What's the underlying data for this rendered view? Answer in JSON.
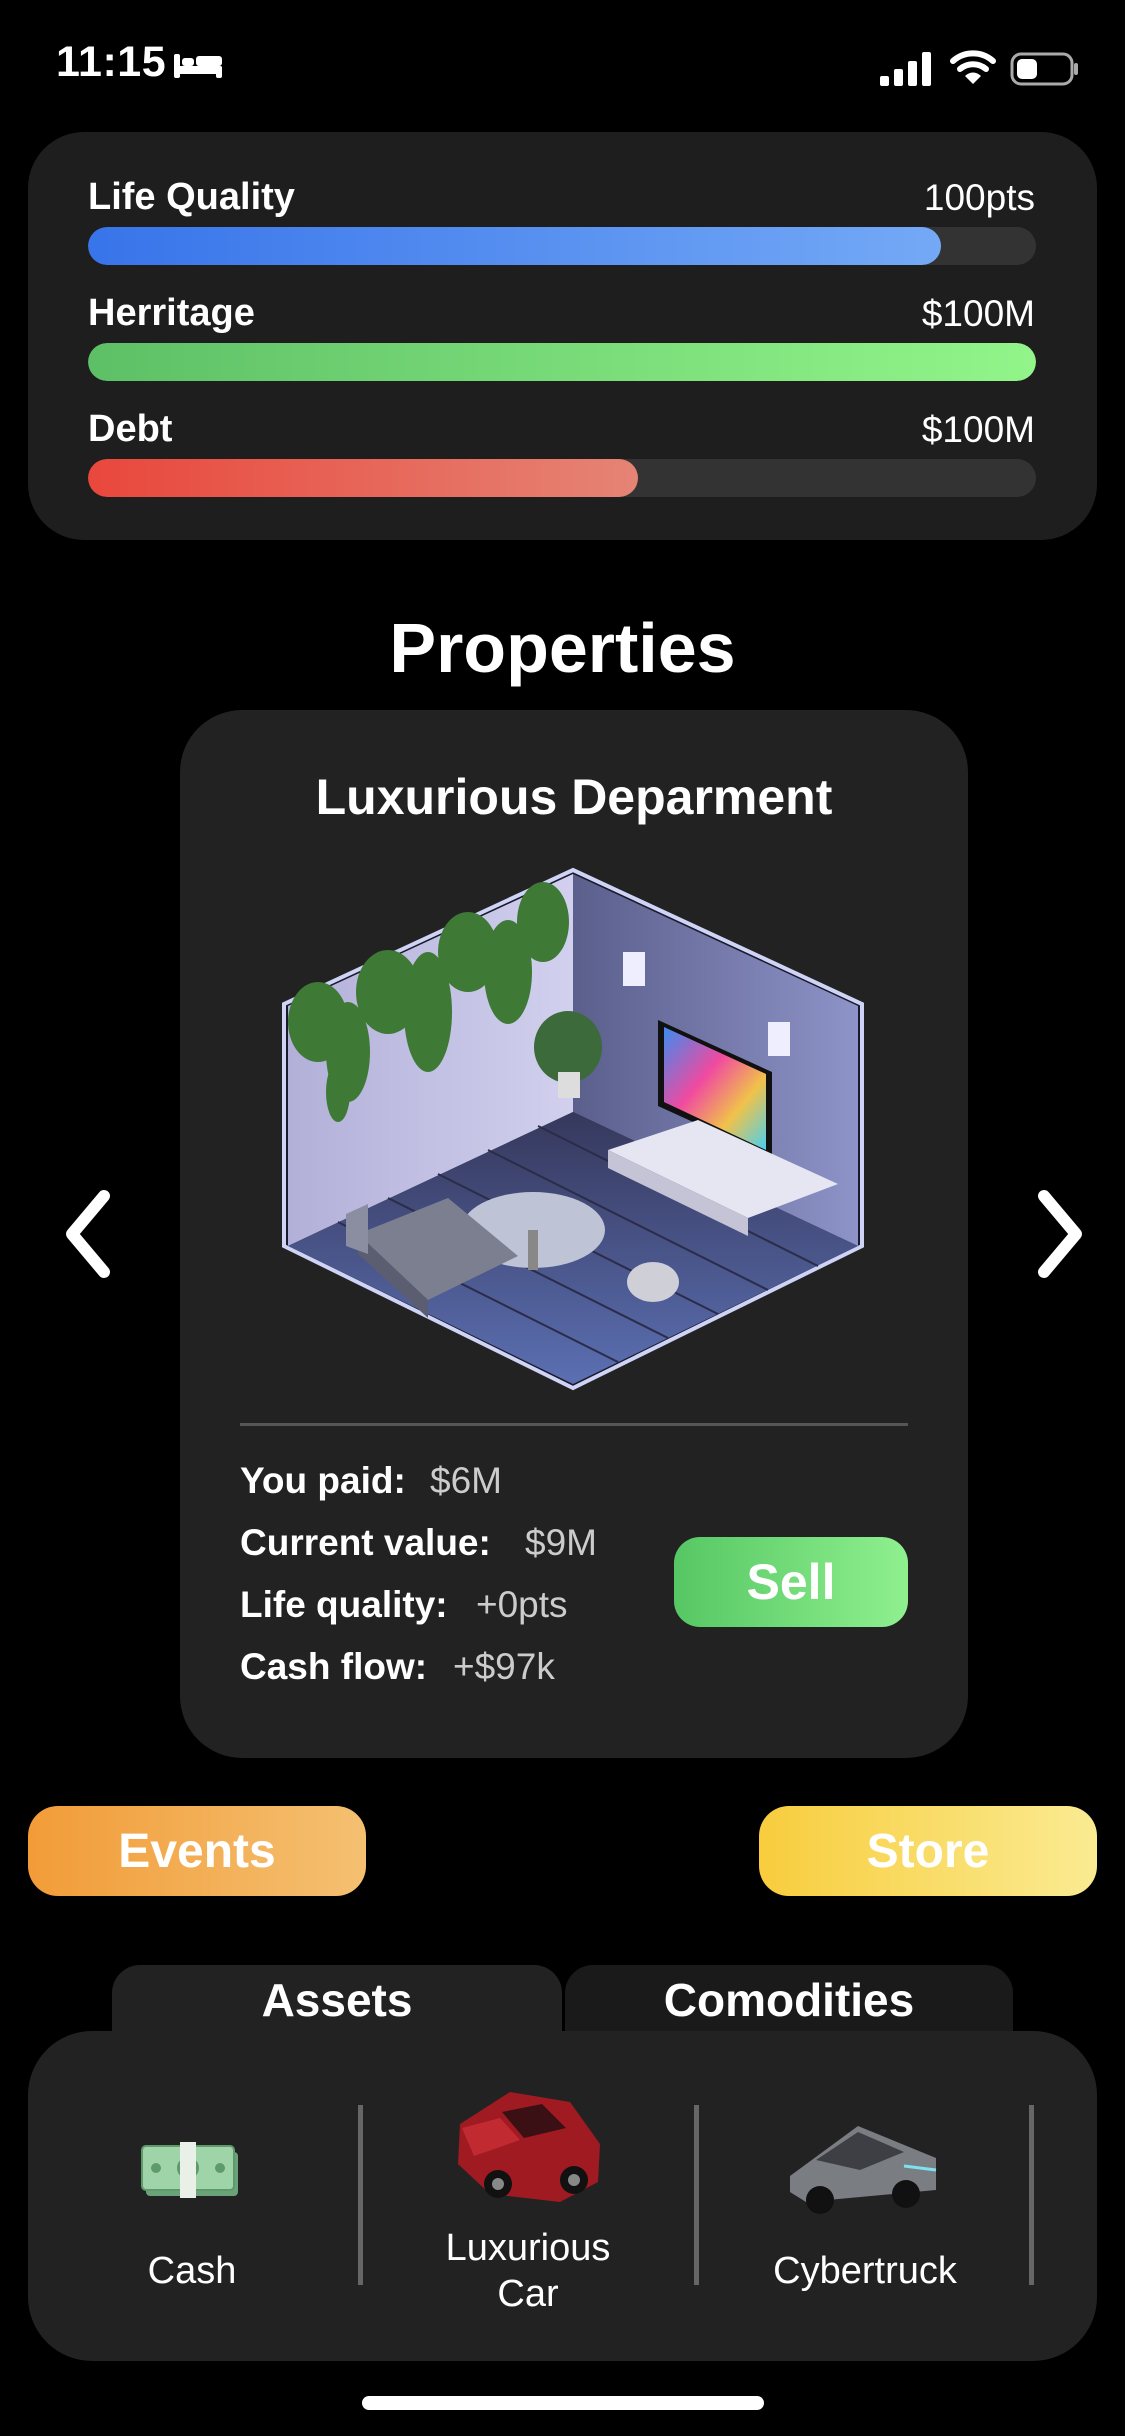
{
  "status_bar": {
    "time": "11:15"
  },
  "stats": [
    {
      "label": "Life Quality",
      "value": "100pts",
      "fill": 0.9,
      "color_start": "#3874ea",
      "color_end": "#74a9f6"
    },
    {
      "label": "Herritage",
      "value": "$100M",
      "fill": 1.0,
      "color_start": "#5ec066",
      "color_end": "#92f58a"
    },
    {
      "label": "Debt",
      "value": "$100M",
      "fill": 0.58,
      "color_start": "#e9473c",
      "color_end": "#e58475"
    }
  ],
  "section_title": "Properties",
  "property": {
    "name": "Luxurious Deparment",
    "details": [
      {
        "label": "You paid:",
        "value": "$6M"
      },
      {
        "label": "Current value:",
        "value": "$9M"
      },
      {
        "label": "Life quality:",
        "value": "+0pts"
      },
      {
        "label": "Cash flow:",
        "value": "+$97k"
      }
    ],
    "sell_label": "Sell"
  },
  "buttons": {
    "events": "Events",
    "store": "Store"
  },
  "tabs": {
    "assets": "Assets",
    "comodities": "Comodities"
  },
  "assets": [
    {
      "label": "Cash",
      "icon": "cash-icon"
    },
    {
      "label": "Luxurious\nCar",
      "icon": "car-icon"
    },
    {
      "label": "Cybertruck",
      "icon": "cybertruck-icon"
    }
  ]
}
